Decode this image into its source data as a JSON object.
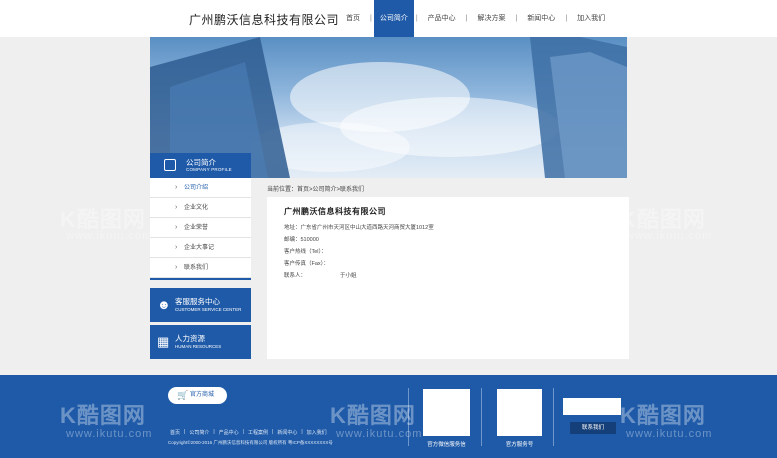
{
  "header": {
    "company_name": "广州鹏沃信息科技有限公司",
    "nav": [
      {
        "label": "首页",
        "active": false
      },
      {
        "label": "公司简介",
        "active": true
      },
      {
        "label": "产品中心",
        "active": false
      },
      {
        "label": "解决方案",
        "active": false
      },
      {
        "label": "新闻中心",
        "active": false
      },
      {
        "label": "加入我们",
        "active": false
      }
    ],
    "separator": "|"
  },
  "sidebar": {
    "title": "公司简介",
    "subtitle": "COMPANY PROFILE",
    "items": [
      {
        "label": "公司介绍",
        "active": true
      },
      {
        "label": "企业文化",
        "active": false
      },
      {
        "label": "企业荣誉",
        "active": false
      },
      {
        "label": "企业大事记",
        "active": false
      },
      {
        "label": "联系我们",
        "active": false
      }
    ],
    "service_title": "客服服务中心",
    "service_subtitle": "CUSTOMER SERVICE CENTER",
    "hr_title": "人力资源",
    "hr_subtitle": "HUMAN RESOURCES"
  },
  "breadcrumb": "当前位置：首页>公司简介>联系我们",
  "content": {
    "title": "广州鹏沃信息科技有限公司",
    "address": "地址：广东省广州市天河区中山大道西路天河商贸大厦1012室",
    "postcode": "邮编：510000",
    "tel": "客户热线（Tel）：",
    "fax": "客户传真（Fax）：",
    "contact_label": "联系人：",
    "contact_name": "于小姐"
  },
  "footer": {
    "mall_button": "官方商城",
    "links": [
      "首页",
      "公司简介",
      "产品中心",
      "工程案例",
      "新闻中心",
      "加入我们"
    ],
    "copyright": "Copyright©2000-2016 广州鹏沃信息科技有限公司 版权所有 粤ICP备XXXXXXXX号",
    "qr1_label": "官方微信服务信",
    "qr2_label": "官方服务号",
    "contact_button": "联系我们"
  },
  "watermark": {
    "brand": "K酷图网",
    "url": "www.ikutu.com"
  },
  "colors": {
    "primary": "#1e5aa8",
    "footer": "#1e5aa8",
    "background": "#efefef"
  }
}
